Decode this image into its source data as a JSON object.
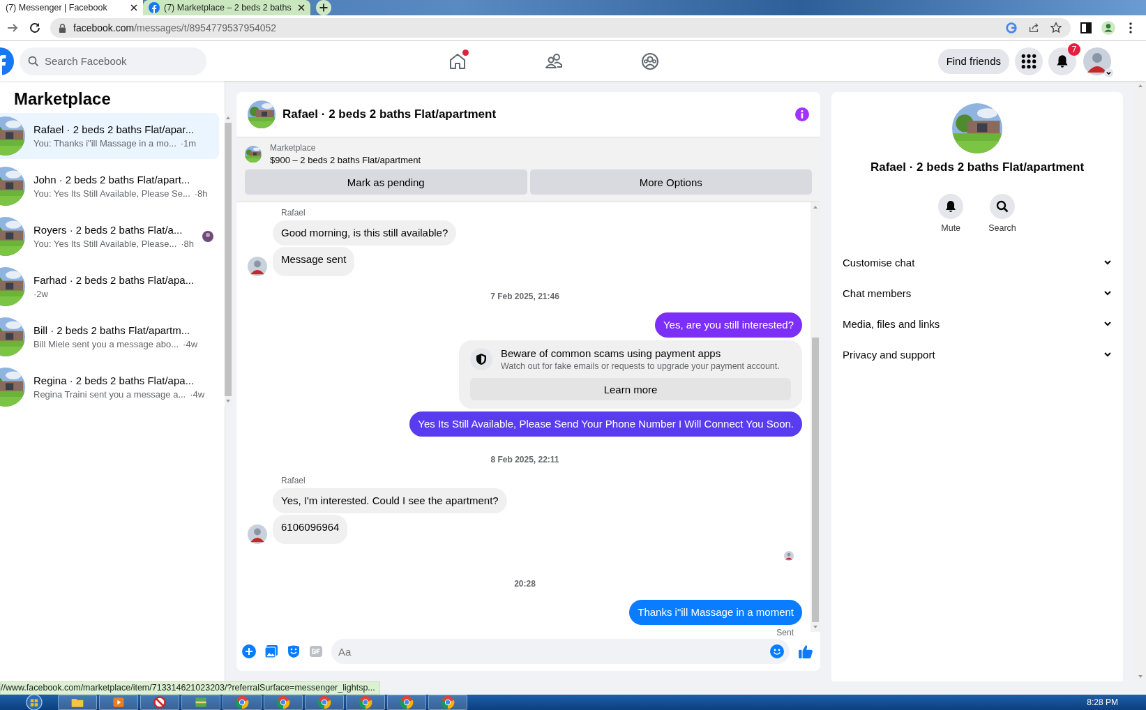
{
  "browser": {
    "tabs": [
      {
        "title": "(7) Messenger | Facebook",
        "selected": false
      },
      {
        "title": "(7) Marketplace – 2 beds 2 baths",
        "selected": true
      }
    ],
    "url_host": "facebook.com",
    "url_path": "/messages/t/8954779537954052"
  },
  "header": {
    "search_placeholder": "Search Facebook",
    "home_has_dot": true,
    "find_friends": "Find friends",
    "notifications": "7"
  },
  "sidebar": {
    "title": "Marketplace",
    "conversations": [
      {
        "title": "Rafael · 2 beds 2 baths Flat/apar...",
        "preview": "You: Thanks i\"ill Massage in a mo...",
        "time": "·1m",
        "selected": true,
        "seen": false
      },
      {
        "title": "John · 2 beds 2 baths Flat/apart...",
        "preview": "You: Yes Its Still Available, Please Se...",
        "time": "·8h",
        "selected": false,
        "seen": false
      },
      {
        "title": "Royers · 2 beds 2 baths Flat/a...",
        "preview": "You: Yes Its Still Available, Please...",
        "time": "·8h",
        "selected": false,
        "seen": true
      },
      {
        "title": "Farhad · 2 beds 2 baths Flat/apa...",
        "time": "·2w",
        "selected": false,
        "seen": false
      },
      {
        "title": "Bill · 2 beds 2 baths Flat/apartm...",
        "preview": "Bill Miele sent you a message abo...",
        "time": "·4w",
        "selected": false,
        "seen": false
      },
      {
        "title": "Regina · 2 beds 2 baths Flat/apa...",
        "preview": "Regina Traini sent you a message a...",
        "time": "·4w",
        "selected": false,
        "seen": false
      }
    ]
  },
  "chat": {
    "title": "Rafael · 2 beds 2 baths Flat/apartment",
    "listing": {
      "label": "Marketplace",
      "text": "$900 – 2 beds 2 baths Flat/apartment",
      "buttons": [
        "Mark as pending",
        "More Options"
      ]
    },
    "messages": [
      {
        "kind": "incoming",
        "sender": "Rafael",
        "bubbles": [
          "Good morning, is this still available?",
          "Message sent"
        ]
      },
      {
        "kind": "separator",
        "text": "7 Feb 2025, 21:46"
      },
      {
        "kind": "outgoing",
        "text": "Yes, are you still interested?",
        "color": "#7b2ff7"
      },
      {
        "kind": "notice",
        "title": "Beware of common scams using payment apps",
        "text": "Watch out for fake emails or requests to upgrade your payment account.",
        "button": "Learn more"
      },
      {
        "kind": "outgoing",
        "text": "Yes Its Still Available, Please Send Your Phone Number I Will Connect You Soon.",
        "color": "#5a3cf0"
      },
      {
        "kind": "separator",
        "text": "8 Feb 2025, 22:11"
      },
      {
        "kind": "incoming",
        "sender": "Rafael",
        "bubbles": [
          "Yes, I'm interested. Could I see the apartment?",
          "6106096964"
        ]
      },
      {
        "kind": "seen"
      },
      {
        "kind": "separator",
        "text": "20:28"
      },
      {
        "kind": "outgoing",
        "text": "Thanks i\"ill Massage in a moment",
        "color": "#0a7cff"
      },
      {
        "kind": "status",
        "text": "Sent"
      }
    ],
    "composer_placeholder": "Aa"
  },
  "info": {
    "title": "Rafael · 2 beds 2 baths Flat/apartment",
    "actions": [
      "Mute",
      "Search"
    ],
    "sections": [
      {
        "label": "Customise chat",
        "expanded": false
      },
      {
        "label": "Chat members",
        "expanded": false
      },
      {
        "label": "Media, files and links",
        "expanded": false
      },
      {
        "label": "Privacy and support",
        "expanded": false
      }
    ]
  },
  "status_link": "//www.facebook.com/marketplace/item/713314621023203/?referralSurface=messenger_lightsp...",
  "taskbar": {
    "time": "8:28 PM"
  }
}
